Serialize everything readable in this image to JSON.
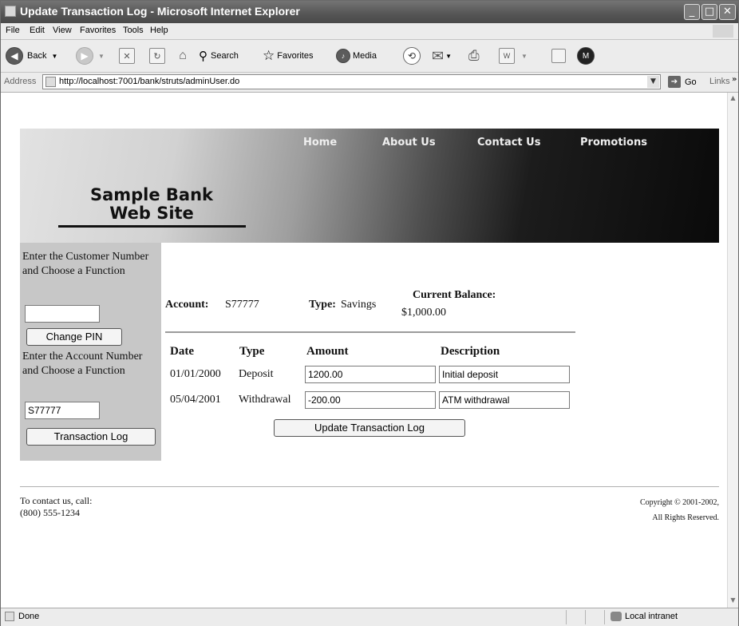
{
  "window": {
    "title": "Update Transaction Log - Microsoft Internet Explorer"
  },
  "menu": [
    "File",
    "Edit",
    "View",
    "Favorites",
    "Tools",
    "Help"
  ],
  "toolbar": {
    "back": "Back",
    "search": "Search",
    "favorites": "Favorites",
    "media": "Media"
  },
  "address": {
    "label": "Address",
    "url": "http://localhost:7001/bank/struts/adminUser.do",
    "go": "Go",
    "links": "Links"
  },
  "banner": {
    "nav": [
      "Home",
      "About Us",
      "Contact Us",
      "Promotions"
    ],
    "brand_line1": "Sample Bank",
    "brand_line2": "Web Site"
  },
  "sidebar": {
    "customer_prompt": "Enter the Customer Number and Choose a Function",
    "customer_value": "",
    "change_pin": "Change PIN",
    "account_prompt": "Enter the Account Number and Choose a Function",
    "account_value": "S77777",
    "transaction_log": "Transaction Log"
  },
  "summary": {
    "account_label": "Account:",
    "account_value": "S77777",
    "type_label": "Type:",
    "type_value": "Savings",
    "balance_label": "Current Balance:",
    "balance_value": "$1,000.00"
  },
  "table": {
    "headers": [
      "Date",
      "Type",
      "Amount",
      "Description"
    ],
    "rows": [
      {
        "date": "01/01/2000",
        "type": "Deposit",
        "amount": "1200.00",
        "description": "Initial deposit"
      },
      {
        "date": "05/04/2001",
        "type": "Withdrawal",
        "amount": "-200.00",
        "description": "ATM withdrawal"
      }
    ]
  },
  "update_button": "Update Transaction Log",
  "footer": {
    "contact_line1": "To contact us, call:",
    "contact_line2": "(800) 555-1234",
    "copyright_line1": "Copyright © 2001-2002,",
    "copyright_line2": "All Rights Reserved."
  },
  "status": {
    "left": "Done",
    "zone": "Local intranet"
  }
}
